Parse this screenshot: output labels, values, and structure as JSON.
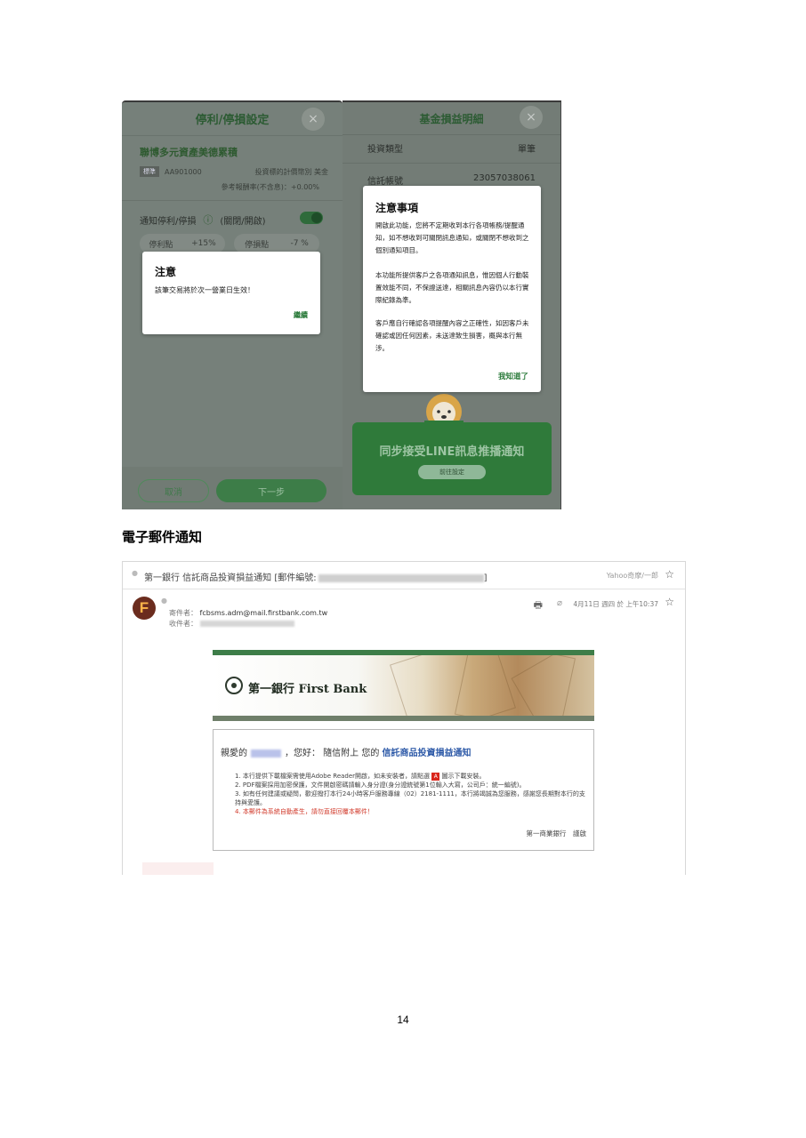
{
  "phone1": {
    "header_title": "停利/停損設定",
    "close_icon": "×",
    "fund_name": "聯博多元資產美德累積",
    "fund_tag": "標準",
    "fund_code": "AA901000",
    "currency_label": "投資標的計價幣別 美金",
    "ref_rate": "參考報酬率(不含息)：+0.00%",
    "notify_label": "通知停利/停損",
    "notify_info_icon": "ⓘ",
    "notify_state": "(關閉/開啟)",
    "pill_profit_label": "停利點",
    "pill_profit_value": "+15%",
    "pill_loss_label": "停損點",
    "pill_loss_value": "-7 %",
    "cancel_label": "取消",
    "next_label": "下一步",
    "dialog": {
      "title": "注意",
      "body": "該筆交易將於次一營業日生效！",
      "button": "繼續"
    }
  },
  "phone2": {
    "header_title": "基金損益明細",
    "close_icon": "×",
    "rows": [
      {
        "label": "投資類型",
        "value": "單筆"
      },
      {
        "label": "信託帳號",
        "value": "23057038061"
      }
    ],
    "dialog": {
      "title": "注意事項",
      "paragraphs": [
        "開啟此功能，您將不定期收到本行各項帳務/提醒通知，如不想收到可關閉訊息通知，或關閉不想收到之個別通知項目。",
        "本功能所提供客戶之各項通知訊息，惟因個人行動裝置效能不同，不保證送達，相關訊息內容仍以本行實際紀錄為準。",
        "客戶應自行確認各項提醒內容之正確性，如因客戶未確認或因任何因素，未送達致生損害，概與本行無涉。"
      ],
      "button": "我知道了"
    },
    "line_banner_title": "同步接受LINE訊息推播通知",
    "line_banner_button": "前往設定"
  },
  "section_heading": "電子郵件通知",
  "email": {
    "subject": "第一銀行 信託商品投資損益通知 [郵件編號:",
    "folder": "Yahoo奇摩/一郎",
    "avatar_letter": "F",
    "from_label": "寄件者：",
    "from_value": "fcbsms.adm@mail.firstbank.com.tw",
    "to_label": "收件者：",
    "date": "4月11日 週四 於 上午10:37",
    "bank_logo_text": "第一銀行 First Bank",
    "greeting_prefix": "親愛的",
    "greeting_middle": "，您好： 隨信附上 您的",
    "greeting_link": "信託商品投資損益通知",
    "items": [
      "1. 本行提供下載檔案需使用Adobe Reader開啟，如未安裝者，請點選",
      "2. PDF檔案採用加密保護，文件開啟密碼請輸入身分證(身分證統號第1位輸入大寫，公司戶：統一編號)。",
      "3. 如有任何建議或疑問，歡迎撥打本行24小時客戶服務專線（02）2181-1111，本行將竭誠為您服務，感謝您長期對本行的支持與愛護。",
      "4. 本郵件為系統自動產生，請勿直接回覆本郵件！"
    ],
    "item1_suffix": "圖示下載安裝。",
    "signature": "第一商業銀行　謹啟"
  },
  "page_number": "14"
}
